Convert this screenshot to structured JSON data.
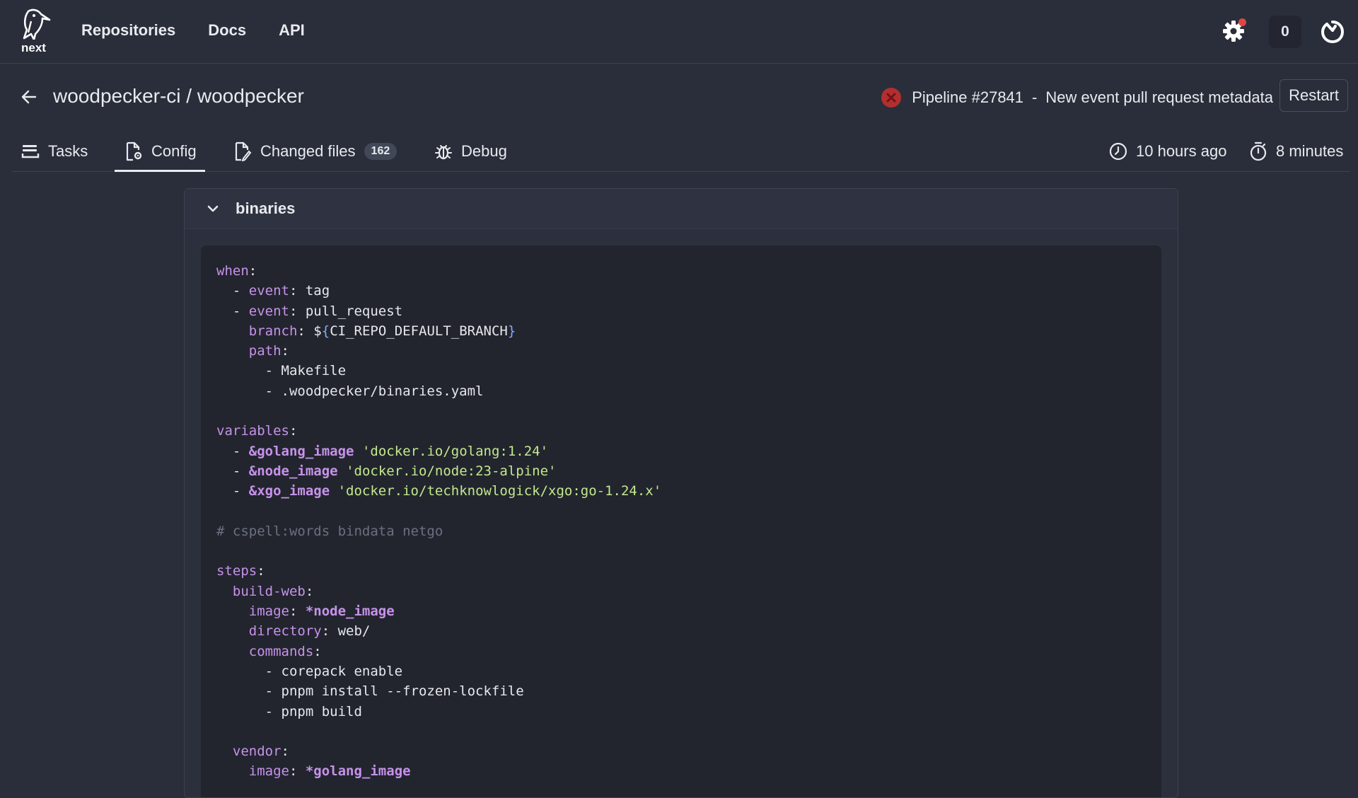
{
  "nav": {
    "logo_text": "next",
    "links": [
      "Repositories",
      "Docs",
      "API"
    ],
    "notification_count": "0"
  },
  "header": {
    "repo_title": "woodpecker-ci / woodpecker",
    "pipeline_label": "Pipeline #27841",
    "pipeline_sep": "-",
    "pipeline_message": "New event pull request metadata",
    "restart_label": "Restart",
    "status": "failed"
  },
  "tabs": {
    "tasks": "Tasks",
    "config": "Config",
    "changed_files": "Changed files",
    "changed_files_count": "162",
    "debug": "Debug",
    "created": "10 hours ago",
    "duration": "8 minutes"
  },
  "panel": {
    "title": "binaries"
  },
  "code_lines": [
    [
      {
        "t": "k",
        "v": "when"
      },
      {
        "t": "p",
        "v": ":"
      }
    ],
    [
      {
        "t": "p",
        "v": "  - "
      },
      {
        "t": "k",
        "v": "event"
      },
      {
        "t": "p",
        "v": ": tag"
      }
    ],
    [
      {
        "t": "p",
        "v": "  - "
      },
      {
        "t": "k",
        "v": "event"
      },
      {
        "t": "p",
        "v": ": pull_request"
      }
    ],
    [
      {
        "t": "p",
        "v": "    "
      },
      {
        "t": "k",
        "v": "branch"
      },
      {
        "t": "p",
        "v": ": $"
      },
      {
        "t": "b",
        "v": "{"
      },
      {
        "t": "p",
        "v": "CI_REPO_DEFAULT_BRANCH"
      },
      {
        "t": "b",
        "v": "}"
      }
    ],
    [
      {
        "t": "p",
        "v": "    "
      },
      {
        "t": "k",
        "v": "path"
      },
      {
        "t": "p",
        "v": ":"
      }
    ],
    [
      {
        "t": "p",
        "v": "      - Makefile"
      }
    ],
    [
      {
        "t": "p",
        "v": "      - .woodpecker/binaries.yaml"
      }
    ],
    [
      {
        "t": "p",
        "v": ""
      }
    ],
    [
      {
        "t": "k",
        "v": "variables"
      },
      {
        "t": "p",
        "v": ":"
      }
    ],
    [
      {
        "t": "p",
        "v": "  - "
      },
      {
        "t": "a",
        "v": "&golang_image"
      },
      {
        "t": "p",
        "v": " "
      },
      {
        "t": "s",
        "v": "'docker.io/golang:1.24'"
      }
    ],
    [
      {
        "t": "p",
        "v": "  - "
      },
      {
        "t": "a",
        "v": "&node_image"
      },
      {
        "t": "p",
        "v": " "
      },
      {
        "t": "s",
        "v": "'docker.io/node:23-alpine'"
      }
    ],
    [
      {
        "t": "p",
        "v": "  - "
      },
      {
        "t": "a",
        "v": "&xgo_image"
      },
      {
        "t": "p",
        "v": " "
      },
      {
        "t": "s",
        "v": "'docker.io/techknowlogick/xgo:go-1.24.x'"
      }
    ],
    [
      {
        "t": "p",
        "v": ""
      }
    ],
    [
      {
        "t": "c",
        "v": "# cspell:words bindata netgo"
      }
    ],
    [
      {
        "t": "p",
        "v": ""
      }
    ],
    [
      {
        "t": "k",
        "v": "steps"
      },
      {
        "t": "p",
        "v": ":"
      }
    ],
    [
      {
        "t": "p",
        "v": "  "
      },
      {
        "t": "k",
        "v": "build-web"
      },
      {
        "t": "p",
        "v": ":"
      }
    ],
    [
      {
        "t": "p",
        "v": "    "
      },
      {
        "t": "k",
        "v": "image"
      },
      {
        "t": "p",
        "v": ": "
      },
      {
        "t": "a",
        "v": "*node_image"
      }
    ],
    [
      {
        "t": "p",
        "v": "    "
      },
      {
        "t": "k",
        "v": "directory"
      },
      {
        "t": "p",
        "v": ": web/"
      }
    ],
    [
      {
        "t": "p",
        "v": "    "
      },
      {
        "t": "k",
        "v": "commands"
      },
      {
        "t": "p",
        "v": ":"
      }
    ],
    [
      {
        "t": "p",
        "v": "      - corepack enable"
      }
    ],
    [
      {
        "t": "p",
        "v": "      - pnpm install --frozen-lockfile"
      }
    ],
    [
      {
        "t": "p",
        "v": "      - pnpm build"
      }
    ],
    [
      {
        "t": "p",
        "v": ""
      }
    ],
    [
      {
        "t": "p",
        "v": "  "
      },
      {
        "t": "k",
        "v": "vendor"
      },
      {
        "t": "p",
        "v": ":"
      }
    ],
    [
      {
        "t": "p",
        "v": "    "
      },
      {
        "t": "k",
        "v": "image"
      },
      {
        "t": "p",
        "v": ": "
      },
      {
        "t": "a",
        "v": "*golang_image"
      }
    ]
  ]
}
